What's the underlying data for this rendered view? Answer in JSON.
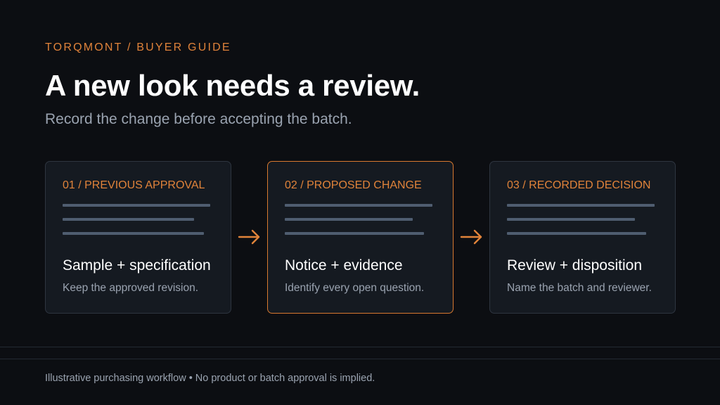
{
  "header": {
    "eyebrow": "TORQMONT / BUYER GUIDE",
    "title": "A new look needs a review.",
    "subtitle": "Record the change before accepting the batch."
  },
  "steps": [
    {
      "label": "01 / PREVIOUS APPROVAL",
      "title": "Sample + specification",
      "description": "Keep the approved revision.",
      "highlighted": false
    },
    {
      "label": "02 / PROPOSED CHANGE",
      "title": "Notice + evidence",
      "description": "Identify every open question.",
      "highlighted": true
    },
    {
      "label": "03 / RECORDED DECISION",
      "title": "Review + disposition",
      "description": "Name the batch and reviewer.",
      "highlighted": false
    }
  ],
  "connector_icon": "arrow-right-icon",
  "footer": {
    "note": "Illustrative purchasing workflow • No product or batch approval is implied."
  },
  "colors": {
    "background": "#0c0e12",
    "accent": "#e0833a",
    "card": "#151a21",
    "card_border": "#2e3540",
    "muted_text": "#9aa3b0",
    "placeholder_line": "#4f5d70"
  }
}
